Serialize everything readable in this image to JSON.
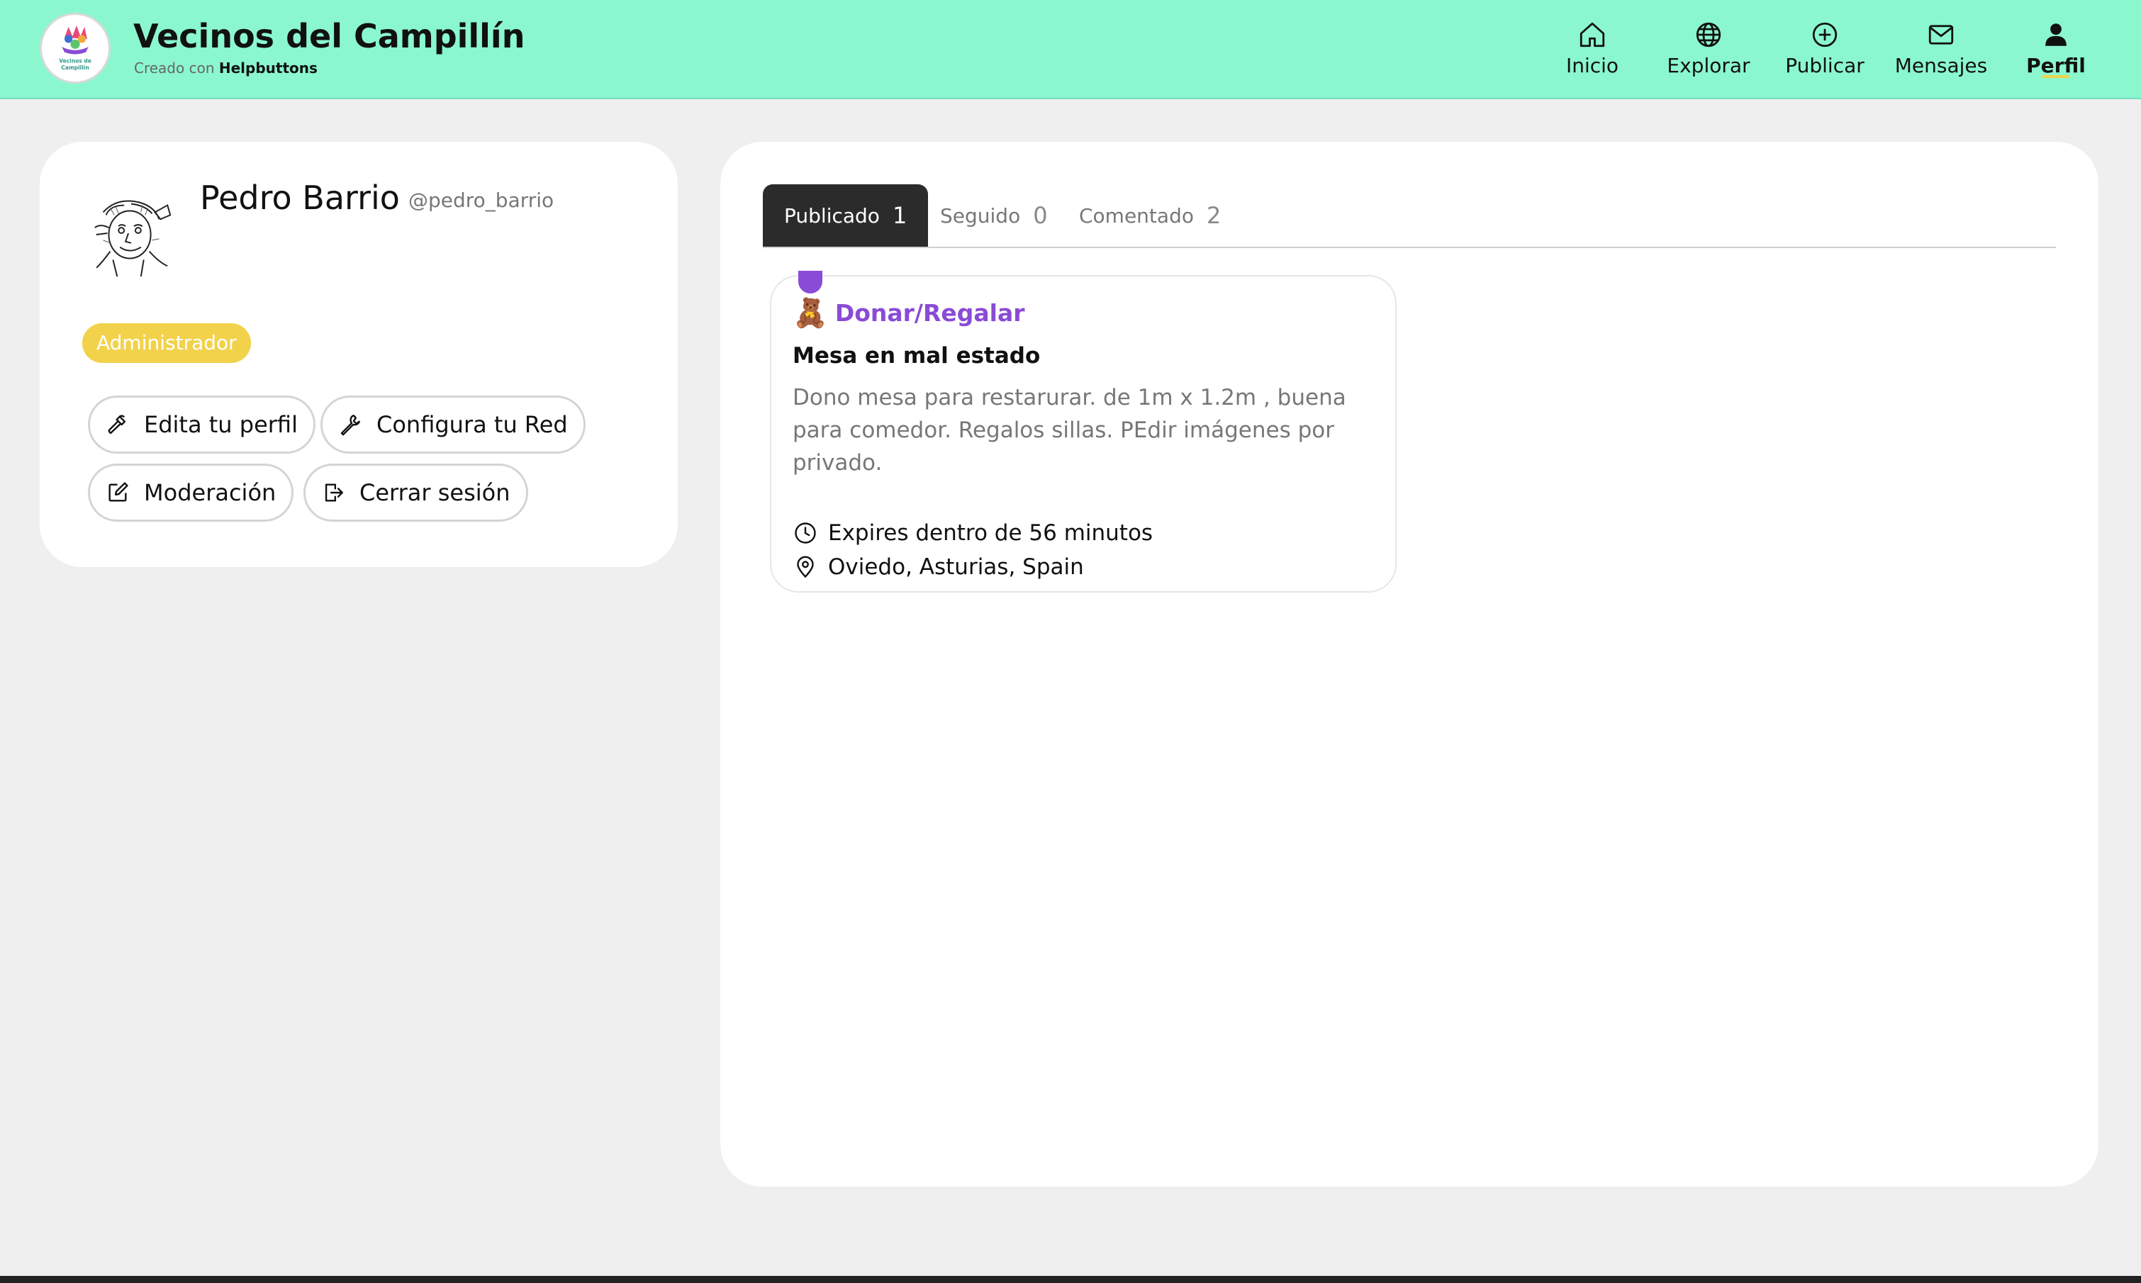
{
  "header": {
    "title": "Vecinos del Campillín",
    "subtitle_prefix": "Creado con",
    "subtitle_brand": "Helpbuttons",
    "logo_text_1": "Vecinos de",
    "logo_text_2": "Campillín",
    "nav": [
      {
        "label": "Inicio",
        "icon": "home-icon"
      },
      {
        "label": "Explorar",
        "icon": "globe-icon"
      },
      {
        "label": "Publicar",
        "icon": "plus-circle-icon"
      },
      {
        "label": "Mensajes",
        "icon": "mail-icon"
      },
      {
        "label": "Perfil",
        "icon": "user-icon",
        "active": true
      }
    ],
    "accent_color": "#8af7cf"
  },
  "profile": {
    "name": "Pedro Barrio",
    "handle": "@pedro_barrio",
    "role": "Administrador",
    "buttons": {
      "edit": "Edita tu perfil",
      "configure": "Configura tu Red",
      "moderation": "Moderación",
      "logout": "Cerrar sesión"
    }
  },
  "tabs": [
    {
      "label": "Publicado",
      "count": "1",
      "active": true
    },
    {
      "label": "Seguido",
      "count": "0"
    },
    {
      "label": "Comentado",
      "count": "2"
    }
  ],
  "posts": [
    {
      "category": "Donar/Regalar",
      "category_emoji": "🧸",
      "category_color": "#8a4bd6",
      "title": "Mesa en mal estado",
      "description": "Dono mesa para restarurar. de 1m x 1.2m , buena para comedor. Regalos sillas. PEdir imágenes por privado.",
      "expires": "Expires dentro de 56 minutos",
      "location": "Oviedo, Asturias, Spain"
    }
  ]
}
